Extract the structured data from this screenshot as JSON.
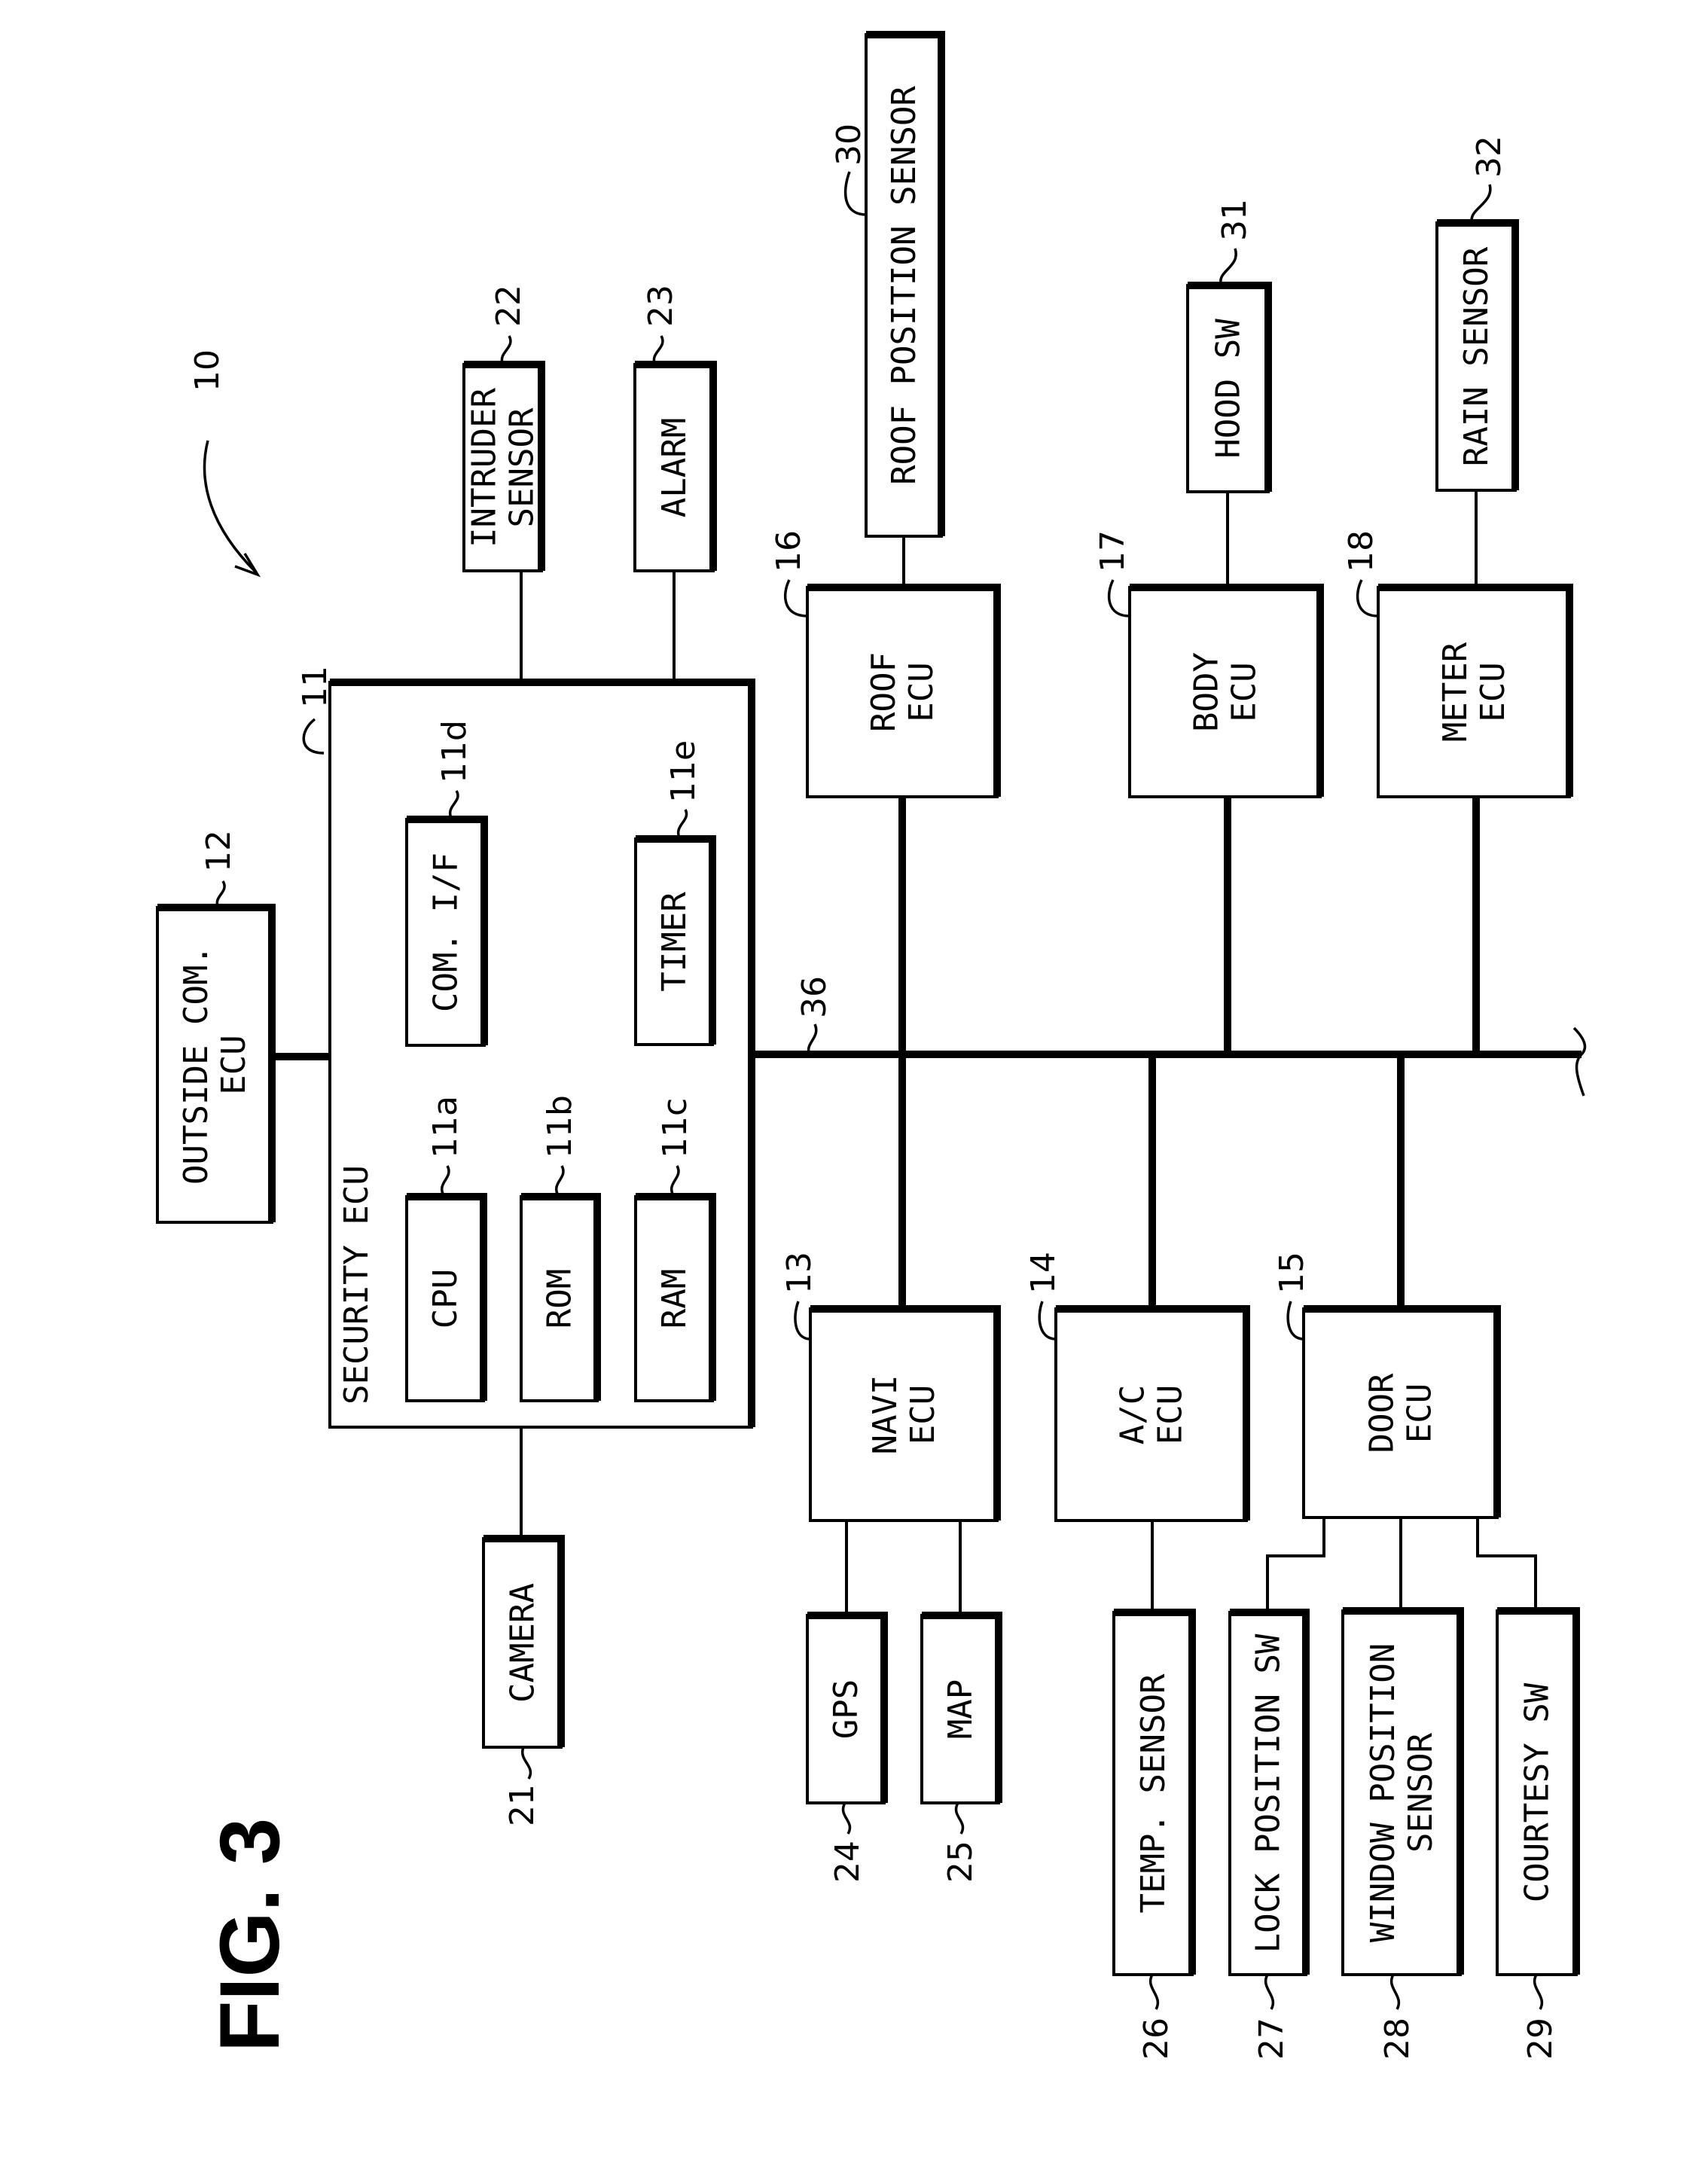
{
  "figure": {
    "title": "FIG. 3",
    "system_ref": "10"
  },
  "blocks": {
    "security_ecu": {
      "label": "SECURITY ECU",
      "ref": "11"
    },
    "cpu": {
      "label": "CPU",
      "ref": "11a"
    },
    "rom": {
      "label": "ROM",
      "ref": "11b"
    },
    "ram": {
      "label": "RAM",
      "ref": "11c"
    },
    "com_if": {
      "label": "COM. I/F",
      "ref": "11d"
    },
    "timer": {
      "label": "TIMER",
      "ref": "11e"
    },
    "outside_com_ecu": {
      "label_lines": [
        "OUTSIDE COM.",
        "ECU"
      ],
      "ref": "12"
    },
    "navi_ecu": {
      "label_lines": [
        "NAVI",
        "ECU"
      ],
      "ref": "13"
    },
    "ac_ecu": {
      "label_lines": [
        "A/C",
        "ECU"
      ],
      "ref": "14"
    },
    "door_ecu": {
      "label_lines": [
        "DOOR",
        "ECU"
      ],
      "ref": "15"
    },
    "roof_ecu": {
      "label_lines": [
        "ROOF",
        "ECU"
      ],
      "ref": "16"
    },
    "body_ecu": {
      "label_lines": [
        "BODY",
        "ECU"
      ],
      "ref": "17"
    },
    "meter_ecu": {
      "label_lines": [
        "METER",
        "ECU"
      ],
      "ref": "18"
    },
    "camera": {
      "label": "CAMERA",
      "ref": "21"
    },
    "intruder_sensor": {
      "label_lines": [
        "INTRUDER",
        "SENSOR"
      ],
      "ref": "22"
    },
    "alarm": {
      "label": "ALARM",
      "ref": "23"
    },
    "gps": {
      "label": "GPS",
      "ref": "24"
    },
    "map": {
      "label": "MAP",
      "ref": "25"
    },
    "temp_sensor": {
      "label": "TEMP. SENSOR",
      "ref": "26"
    },
    "lock_position_sw": {
      "label": "LOCK POSITION SW",
      "ref": "27"
    },
    "window_position_sensor": {
      "label_lines": [
        "WINDOW POSITION",
        "SENSOR"
      ],
      "ref": "28"
    },
    "courtesy_sw": {
      "label": "COURTESY SW",
      "ref": "29"
    },
    "roof_position_sensor": {
      "label": "ROOF POSITION SENSOR",
      "ref": "30"
    },
    "hood_sw": {
      "label": "HOOD SW",
      "ref": "31"
    },
    "rain_sensor": {
      "label": "RAIN SENSOR",
      "ref": "32"
    },
    "bus": {
      "ref": "36"
    }
  }
}
